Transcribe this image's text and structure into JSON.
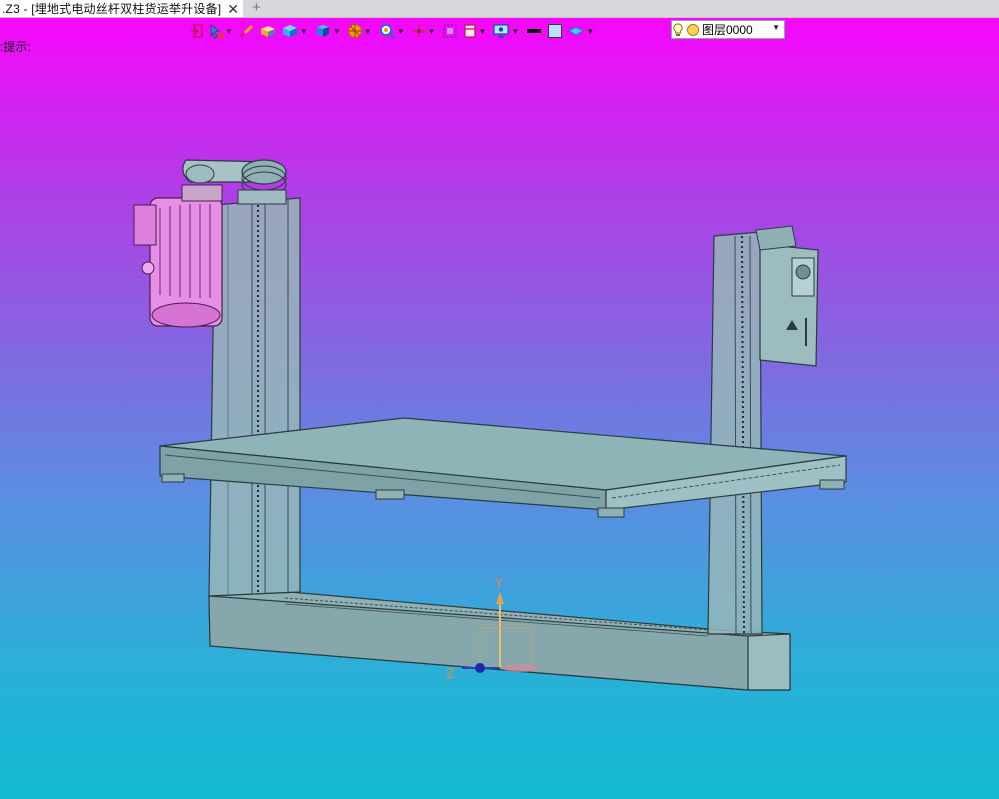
{
  "tab": {
    "title": ".Z3 - [埋地式电动丝杆双柱货运举升设备]",
    "close_symbol": "✕",
    "add_symbol": "+"
  },
  "toolbar": {
    "tools": [
      "exit-icon",
      "pointer-filter-icon",
      "brush-icon",
      "solid-shade-icon",
      "cube-shade-icon",
      "cube-view-icon",
      "display-mode-icon",
      "zoom-icon",
      "pan-axis-icon",
      "fit-frame-icon",
      "section-plane-icon",
      "display-settings-icon",
      "line-color-icon",
      "fill-color-icon",
      "material-icon"
    ],
    "layer": {
      "value": "图层0000"
    }
  },
  "status": {
    "hint": ":提示:"
  },
  "viewport": {
    "background_top": "#ff00ff",
    "background_bottom": "#12bcd4",
    "model_color": "#8fb4b8",
    "motor_color": "#e78ee6",
    "axis_labels": {
      "y": "Y",
      "z": "Z"
    }
  }
}
